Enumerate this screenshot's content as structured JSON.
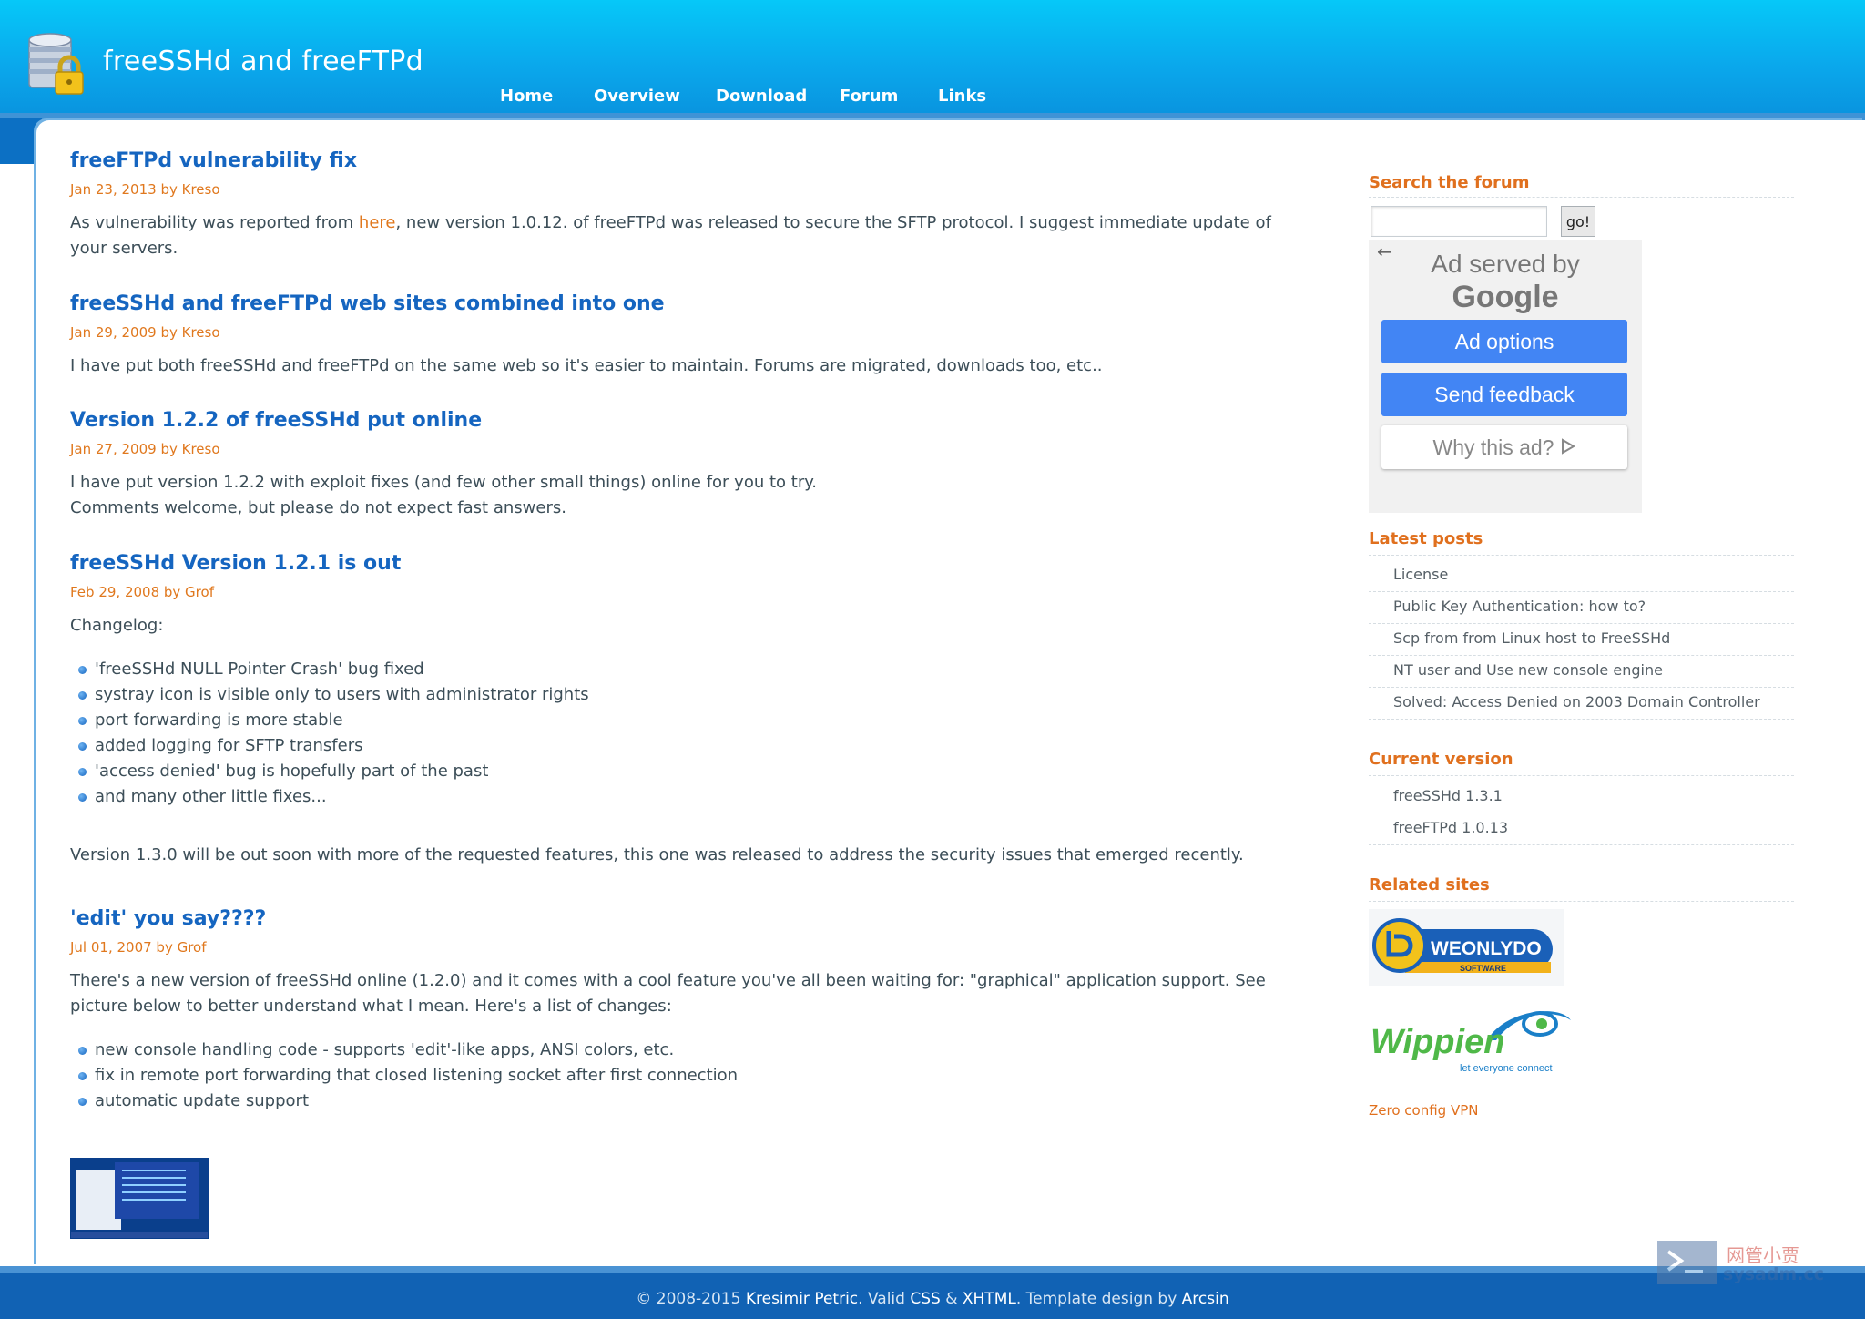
{
  "site": {
    "title": "freeSSHd and freeFTPd",
    "nav": [
      "Home",
      "Overview",
      "Download",
      "Forum",
      "Links"
    ]
  },
  "posts": [
    {
      "title": "freeFTPd vulnerability fix",
      "meta": "Jan 23, 2013 by Kreso",
      "text_before": "As vulnerability was reported from ",
      "link": "here",
      "text_after": ", new version 1.0.12. of freeFTPd was released to secure the SFTP protocol. I suggest immediate update of your servers."
    },
    {
      "title": "freeSSHd and freeFTPd web sites combined into one",
      "meta": "Jan 29, 2009 by Kreso",
      "text": "I have put both freeSSHd and freeFTPd on the same web so it's easier to maintain. Forums are migrated, downloads too, etc.."
    },
    {
      "title": "Version 1.2.2 of freeSSHd put online",
      "meta": "Jan 27, 2009 by Kreso",
      "text_line1": "I have put version 1.2.2 with exploit fixes (and few other small things) online for you to try.",
      "text_line2": "Comments welcome, but please do not expect fast answers."
    },
    {
      "title": "freeSSHd Version 1.2.1 is out",
      "meta": "Feb 29, 2008 by Grof",
      "intro": "Changelog:",
      "bullets": [
        "'freeSSHd NULL Pointer Crash' bug fixed",
        "systray icon is visible only to users with administrator rights",
        "port forwarding is more stable",
        "added logging for SFTP transfers",
        "'access denied' bug is hopefully part of the past",
        "and many other little fixes..."
      ],
      "outro": "Version 1.3.0 will be out soon with more of the requested features, this one was released to address the security issues that emerged recently."
    },
    {
      "title": "'edit' you say????",
      "meta": "Jul 01, 2007 by Grof",
      "text": "There's a new version of freeSSHd online (1.2.0) and it comes with a cool feature you've all been waiting for: \"graphical\" application support. See picture below to better understand what I mean. Here's a list of changes:",
      "bullets": [
        "new console handling code - supports 'edit'-like apps, ANSI colors, etc.",
        "fix in remote port forwarding that closed listening socket after first connection",
        "automatic update support"
      ]
    }
  ],
  "sidebar": {
    "search_heading": "Search the forum",
    "search_value": "",
    "search_button": "go!",
    "ad": {
      "back_icon": "arrow-left-icon",
      "served_by": "Ad served by",
      "google": "Google",
      "options": "Ad options",
      "feedback": "Send feedback",
      "why": "Why this ad?",
      "why_icon": "play-triangle-icon"
    },
    "latest_heading": "Latest posts",
    "latest_posts": [
      "License",
      "Public Key Authentication: how to?",
      "Scp from from Linux host to FreeSSHd",
      "NT user and Use new console engine",
      "Solved: Access Denied on 2003 Domain Controller"
    ],
    "version_heading": "Current version",
    "versions": [
      "freeSSHd 1.3.1",
      "freeFTPd 1.0.13"
    ],
    "related_heading": "Related sites",
    "related_logo_1": "WEONLYDO",
    "related_logo_1_sub": "SOFTWARE",
    "related_logo_2": "Wippien",
    "related_logo_2_sub": "let everyone connect",
    "related_link": "Zero config VPN"
  },
  "footer": {
    "copyright": "© 2008-2015 ",
    "author": "Kresimir Petric",
    "valid": ". Valid ",
    "css": "CSS",
    "amp": " & ",
    "xhtml": "XHTML",
    "template": ". Template design by ",
    "designer": "Arcsin"
  },
  "watermark": {
    "cn": "网管小贾",
    "en": "sysadm.cc"
  },
  "colors": {
    "header_top": "#06c8f8",
    "header_bottom": "#0880d2",
    "post_title": "#1565c0",
    "meta": "#e0781e",
    "sidebar_heading": "#e0701e",
    "ad_button": "#4285f4",
    "footer": "#1162b4"
  }
}
